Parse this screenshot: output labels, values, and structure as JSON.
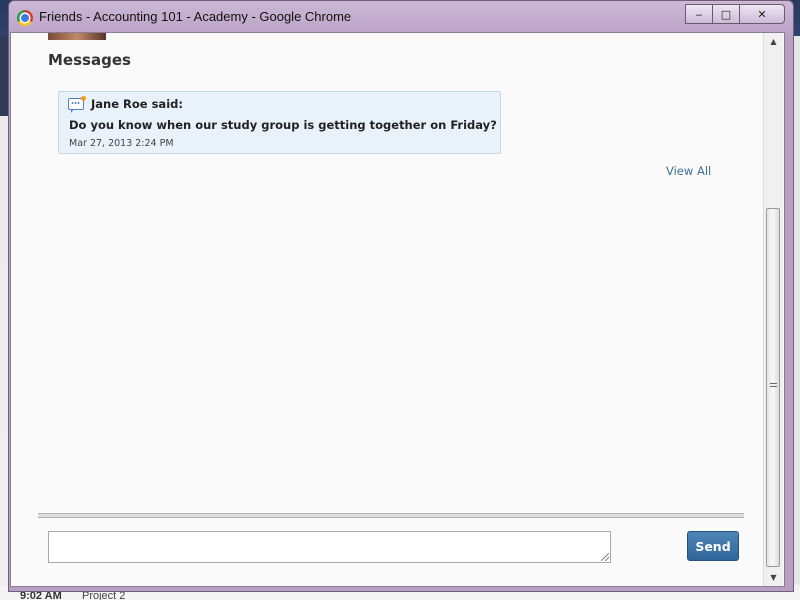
{
  "window": {
    "title": "Friends - Accounting 101 - Academy - Google Chrome",
    "controls": {
      "minimize": "‒",
      "maximize": "□",
      "close": "✕"
    }
  },
  "background": {
    "status_time": "9:02 AM",
    "status_project": "Project 2"
  },
  "messages": {
    "heading": "Messages",
    "items": [
      {
        "author": "Jane Roe said:",
        "text": "Do you know when our study group is getting together on Friday?",
        "timestamp": "Mar 27, 2013 2:24 PM",
        "icon": "chat-bubble-icon"
      }
    ],
    "view_all_label": "View All"
  },
  "composer": {
    "input_value": "",
    "send_label": "Send"
  },
  "scrollbar": {
    "up_arrow": "▲",
    "down_arrow": "▼"
  },
  "colors": {
    "window_frame": "#b79fc4",
    "message_card_bg": "#e9f2fb",
    "link": "#3e6f98",
    "send_button": "#2f6598"
  }
}
